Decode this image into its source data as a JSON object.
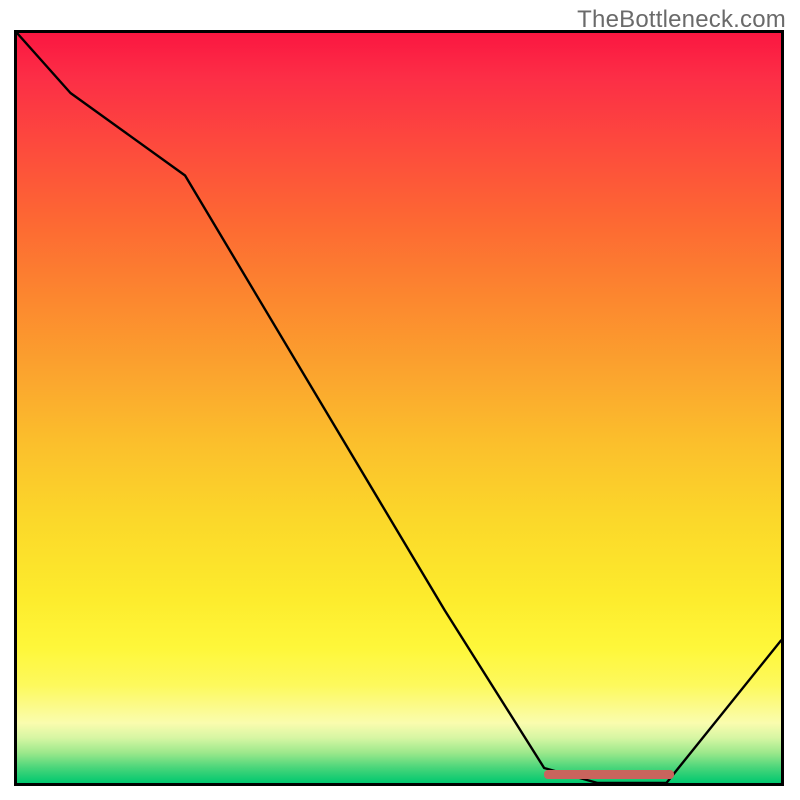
{
  "watermark": "TheBottleneck.com",
  "chart_data": {
    "type": "line",
    "title": "",
    "xlabel": "",
    "ylabel": "",
    "xlim": [
      0,
      100
    ],
    "ylim": [
      0,
      100
    ],
    "x": [
      0,
      7,
      22,
      56,
      69,
      76,
      85,
      100
    ],
    "values": [
      100,
      92,
      81,
      23,
      2,
      0,
      0,
      19
    ],
    "marker": {
      "x_start": 69,
      "x_end": 86,
      "y": 0.5
    },
    "gradient_note": "background encodes bottleneck severity — red (top) to green (bottom)"
  }
}
